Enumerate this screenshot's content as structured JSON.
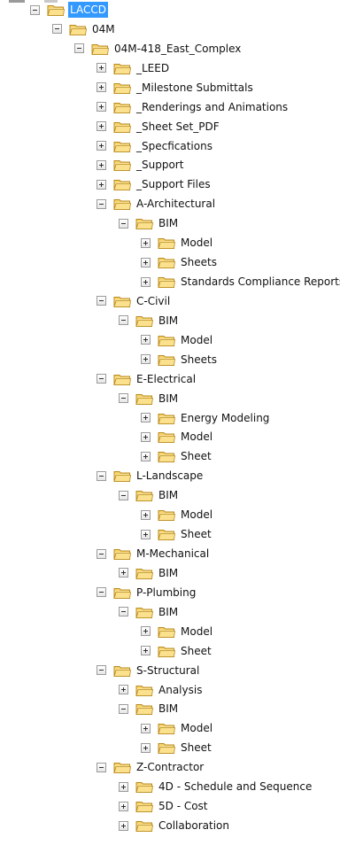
{
  "tree": [
    {
      "label": "LACCD",
      "depth": 0,
      "state": "expanded",
      "selected": true
    },
    {
      "label": "04M",
      "depth": 1,
      "state": "expanded"
    },
    {
      "label": "04M-418_East_Complex",
      "depth": 2,
      "state": "expanded"
    },
    {
      "label": "_LEED",
      "depth": 3,
      "state": "collapsed"
    },
    {
      "label": "_Milestone Submittals",
      "depth": 3,
      "state": "collapsed"
    },
    {
      "label": "_Renderings and Animations",
      "depth": 3,
      "state": "collapsed"
    },
    {
      "label": "_Sheet Set_PDF",
      "depth": 3,
      "state": "collapsed"
    },
    {
      "label": "_Specfications",
      "depth": 3,
      "state": "collapsed"
    },
    {
      "label": "_Support",
      "depth": 3,
      "state": "collapsed"
    },
    {
      "label": "_Support Files",
      "depth": 3,
      "state": "collapsed"
    },
    {
      "label": "A-Architectural",
      "depth": 3,
      "state": "expanded"
    },
    {
      "label": "BIM",
      "depth": 4,
      "state": "expanded"
    },
    {
      "label": "Model",
      "depth": 5,
      "state": "collapsed"
    },
    {
      "label": "Sheets",
      "depth": 5,
      "state": "collapsed"
    },
    {
      "label": "Standards Compliance Reports",
      "depth": 5,
      "state": "collapsed"
    },
    {
      "label": "C-Civil",
      "depth": 3,
      "state": "expanded"
    },
    {
      "label": "BIM",
      "depth": 4,
      "state": "expanded"
    },
    {
      "label": "Model",
      "depth": 5,
      "state": "collapsed"
    },
    {
      "label": "Sheets",
      "depth": 5,
      "state": "collapsed"
    },
    {
      "label": "E-Electrical",
      "depth": 3,
      "state": "expanded"
    },
    {
      "label": "BIM",
      "depth": 4,
      "state": "expanded"
    },
    {
      "label": "Energy Modeling",
      "depth": 5,
      "state": "collapsed"
    },
    {
      "label": "Model",
      "depth": 5,
      "state": "collapsed"
    },
    {
      "label": "Sheet",
      "depth": 5,
      "state": "collapsed"
    },
    {
      "label": "L-Landscape",
      "depth": 3,
      "state": "expanded"
    },
    {
      "label": "BIM",
      "depth": 4,
      "state": "expanded"
    },
    {
      "label": "Model",
      "depth": 5,
      "state": "collapsed"
    },
    {
      "label": "Sheet",
      "depth": 5,
      "state": "collapsed"
    },
    {
      "label": "M-Mechanical",
      "depth": 3,
      "state": "expanded"
    },
    {
      "label": "BIM",
      "depth": 4,
      "state": "collapsed"
    },
    {
      "label": "P-Plumbing",
      "depth": 3,
      "state": "expanded"
    },
    {
      "label": "BIM",
      "depth": 4,
      "state": "expanded"
    },
    {
      "label": "Model",
      "depth": 5,
      "state": "collapsed"
    },
    {
      "label": "Sheet",
      "depth": 5,
      "state": "collapsed"
    },
    {
      "label": "S-Structural",
      "depth": 3,
      "state": "expanded"
    },
    {
      "label": "Analysis",
      "depth": 4,
      "state": "collapsed"
    },
    {
      "label": "BIM",
      "depth": 4,
      "state": "expanded"
    },
    {
      "label": "Model",
      "depth": 5,
      "state": "collapsed"
    },
    {
      "label": "Sheet",
      "depth": 5,
      "state": "collapsed"
    },
    {
      "label": "Z-Contractor",
      "depth": 3,
      "state": "expanded"
    },
    {
      "label": "4D - Schedule and Sequence",
      "depth": 4,
      "state": "collapsed"
    },
    {
      "label": "5D - Cost",
      "depth": 4,
      "state": "collapsed"
    },
    {
      "label": "Collaboration",
      "depth": 4,
      "state": "collapsed"
    }
  ],
  "colors": {
    "folder_fill": "#f6d36b",
    "folder_outline": "#b88a1f",
    "selection": "#3399ff"
  },
  "icons": {
    "folder": "folder-icon",
    "expanded": "collapse-toggle-icon",
    "collapsed": "expand-toggle-icon"
  }
}
